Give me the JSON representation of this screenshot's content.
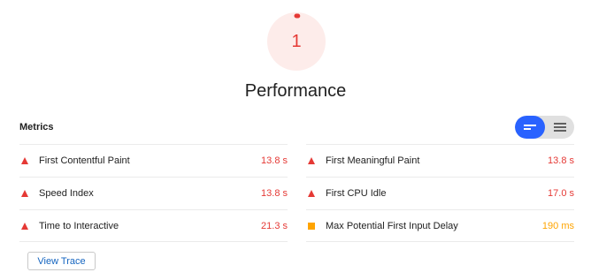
{
  "score": {
    "value": "1",
    "fraction": 0.01,
    "color": "#e53935",
    "background": "#fdecea"
  },
  "category_title": "Performance",
  "metrics": {
    "header": "Metrics",
    "toggle": {
      "options": [
        {
          "icon": "lines-short-icon",
          "active": true
        },
        {
          "icon": "lines-full-icon",
          "active": false
        }
      ],
      "active_color": "#2962ff"
    },
    "left": [
      {
        "label": "First Contentful Paint",
        "value": "13.8 s",
        "status": "fail",
        "icon": "triangle-warning-icon"
      },
      {
        "label": "Speed Index",
        "value": "13.8 s",
        "status": "fail",
        "icon": "triangle-warning-icon"
      },
      {
        "label": "Time to Interactive",
        "value": "21.3 s",
        "status": "fail",
        "icon": "triangle-warning-icon"
      }
    ],
    "right": [
      {
        "label": "First Meaningful Paint",
        "value": "13.8 s",
        "status": "fail",
        "icon": "triangle-warning-icon"
      },
      {
        "label": "First CPU Idle",
        "value": "17.0 s",
        "status": "fail",
        "icon": "triangle-warning-icon"
      },
      {
        "label": "Max Potential First Input Delay",
        "value": "190 ms",
        "status": "average",
        "icon": "square-average-icon"
      }
    ],
    "status_colors": {
      "fail": "#e53935",
      "average": "#ffa400"
    }
  },
  "view_trace_label": "View Trace"
}
